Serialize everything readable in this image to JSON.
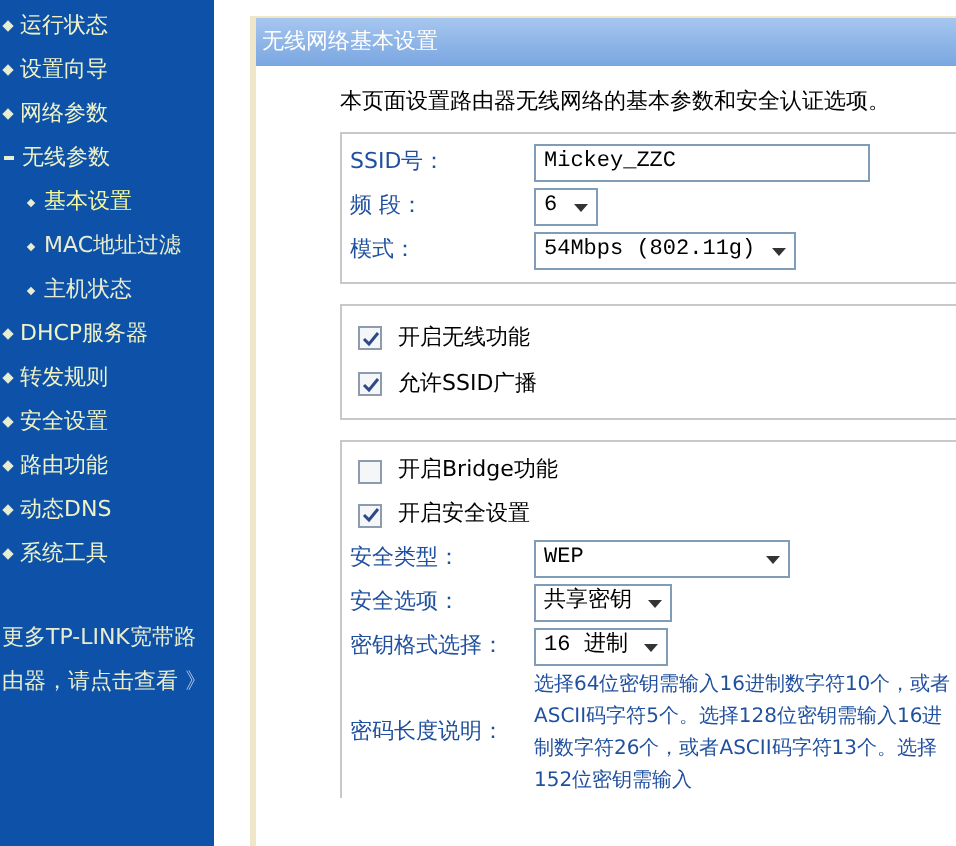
{
  "sidebar": {
    "items": [
      {
        "label": "运行状态",
        "expanded": false
      },
      {
        "label": "设置向导",
        "expanded": false
      },
      {
        "label": "网络参数",
        "expanded": false
      },
      {
        "label": "无线参数",
        "expanded": true,
        "children": [
          {
            "label": "基本设置",
            "selected": true
          },
          {
            "label": "MAC地址过滤",
            "selected": false
          },
          {
            "label": "主机状态",
            "selected": false
          }
        ]
      },
      {
        "label": "DHCP服务器",
        "expanded": false
      },
      {
        "label": "转发规则",
        "expanded": false
      },
      {
        "label": "安全设置",
        "expanded": false
      },
      {
        "label": "路由功能",
        "expanded": false
      },
      {
        "label": "动态DNS",
        "expanded": false
      },
      {
        "label": "系统工具",
        "expanded": false
      }
    ],
    "promo": {
      "text": "更多TP-LINK宽带路由器，请点击查看",
      "arrow": "》"
    }
  },
  "panel": {
    "title": "无线网络基本设置",
    "description": "本页面设置路由器无线网络的基本参数和安全认证选项。",
    "basic": [
      {
        "kind": "input",
        "label": "SSID号：",
        "value": "Mickey_ZZC"
      },
      {
        "kind": "select",
        "label": "频 段：",
        "value": "6"
      },
      {
        "kind": "select",
        "label": "模式：",
        "value": "54Mbps (802.11g)"
      }
    ],
    "switches": [
      {
        "label": "开启无线功能",
        "checked": true
      },
      {
        "label": "允许SSID广播",
        "checked": true
      }
    ],
    "security": [
      {
        "kind": "checkbox",
        "label": "开启Bridge功能",
        "checked": false
      },
      {
        "kind": "checkbox",
        "label": "开启安全设置",
        "checked": true
      },
      {
        "kind": "select",
        "label": "安全类型：",
        "value": "WEP"
      },
      {
        "kind": "select",
        "label": "安全选项：",
        "value": "共享密钥"
      },
      {
        "kind": "select",
        "label": "密钥格式选择：",
        "value": "16 进制"
      },
      {
        "kind": "note",
        "label": "密码长度说明：",
        "value": "选择64位密钥需输入16进制数字符10个，或者ASCII码字符5个。选择128位密钥需输入16进制数字符26个，或者ASCII码字符13个。选择152位密钥需输入"
      }
    ]
  }
}
